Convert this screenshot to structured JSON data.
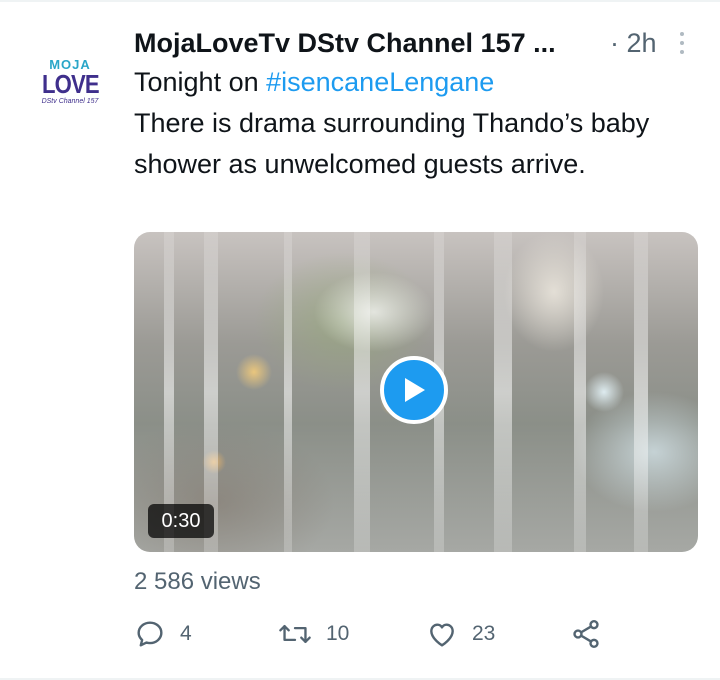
{
  "tweet": {
    "display_name": "MojaLoveTv DStv Channel 157 ...",
    "timestamp": "· 2h",
    "avatar": {
      "line1": "MOJA",
      "line2": "LOVE",
      "line3": "DStv Channel 157"
    },
    "text": {
      "line_prefix": "Tonight on ",
      "hashtag": "#isencaneLengane",
      "body": "There is drama surrounding Thando’s baby shower as unwelcomed guests arrive."
    },
    "media": {
      "duration": "0:30"
    },
    "views": "2 586 views",
    "actions": {
      "reply_count": "4",
      "retweet_count": "10",
      "like_count": "23"
    }
  },
  "colors": {
    "accent": "#1d9bf0",
    "secondary_text": "#536471",
    "primary_text": "#0f1419",
    "logo_teal": "#2aa6c8",
    "logo_purple": "#3f2f8c"
  },
  "icons": [
    "more-vertical-icon",
    "play-icon",
    "reply-icon",
    "retweet-icon",
    "like-icon",
    "share-icon"
  ]
}
